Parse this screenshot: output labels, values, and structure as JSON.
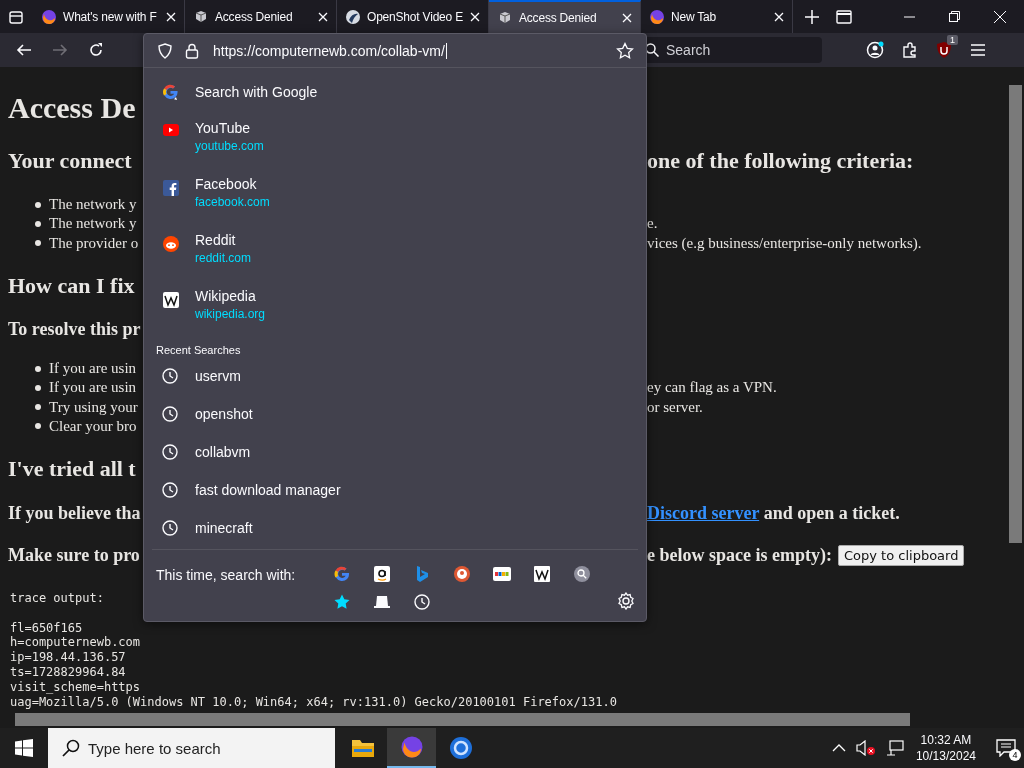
{
  "tabs": [
    {
      "title": "What's new with F",
      "selected": false
    },
    {
      "title": "Access Denied",
      "selected": false
    },
    {
      "title": "OpenShot Video E",
      "selected": false
    },
    {
      "title": "Access Denied",
      "selected": true
    },
    {
      "title": "New Tab",
      "selected": false
    }
  ],
  "nav": {
    "forward_disabled": true,
    "search_placeholder": "Search",
    "addon_badge": "1"
  },
  "urlbar": {
    "value": "https://computernewb.com/collab-vm/"
  },
  "suggestions": [
    {
      "kind": "search",
      "title": "Search with Google"
    },
    {
      "kind": "site",
      "title": "YouTube",
      "url": "youtube.com"
    },
    {
      "kind": "site",
      "title": "Facebook",
      "url": "facebook.com"
    },
    {
      "kind": "site",
      "title": "Reddit",
      "url": "reddit.com"
    },
    {
      "kind": "site",
      "title": "Wikipedia",
      "url": "wikipedia.org"
    }
  ],
  "recent": {
    "heading": "Recent Searches",
    "items": [
      "uservm",
      "openshot",
      "collabvm",
      "fast download manager",
      "minecraft"
    ]
  },
  "engines": {
    "label": "This time, search with:"
  },
  "page": {
    "lines": [
      {
        "kind": "h1",
        "left": "Access De"
      },
      {
        "kind": "h2",
        "left": "Your connect",
        "right": "one of the following criteria:"
      },
      {
        "kind": "li",
        "left": "The network y"
      },
      {
        "kind": "li",
        "left": "The network y",
        "right": "e."
      },
      {
        "kind": "li",
        "left": "The provider o",
        "right": "vices (e.g business/enterprise-only networks)."
      },
      {
        "kind": "h2",
        "left": "How can I fix"
      },
      {
        "kind": "h3",
        "left": "To resolve this pr"
      },
      {
        "kind": "li",
        "left": "If you are usin"
      },
      {
        "kind": "li",
        "left": "If you are usin",
        "right": "ey can flag as a VPN."
      },
      {
        "kind": "li",
        "left": "Try using your",
        "right": "or server."
      },
      {
        "kind": "li",
        "left": "Clear your bro"
      },
      {
        "kind": "h2",
        "left": "I've tried all t"
      },
      {
        "kind": "h3",
        "left": "If you believe tha",
        "link": "Discord server",
        "right": " and open a ticket."
      },
      {
        "kind": "h3",
        "left": "Make sure to pro",
        "right": "e below space is empty):",
        "button": "Copy to clipboard"
      }
    ],
    "trace_title": "trace output:",
    "trace_lines": [
      "fl=650f165",
      "h=computernewb.com",
      "ip=198.44.136.57",
      "ts=1728829964.84",
      "visit_scheme=https",
      "uag=Mozilla/5.0 (Windows NT 10.0; Win64; x64; rv:131.0) Gecko/20100101 Firefox/131.0"
    ]
  },
  "taskbar": {
    "search_placeholder": "Type here to search",
    "apps": [
      {
        "active": false
      },
      {
        "active": true
      },
      {
        "active": false
      }
    ],
    "time": "10:32 AM",
    "date": "10/13/2024",
    "notifications": "4",
    "muted": true
  }
}
